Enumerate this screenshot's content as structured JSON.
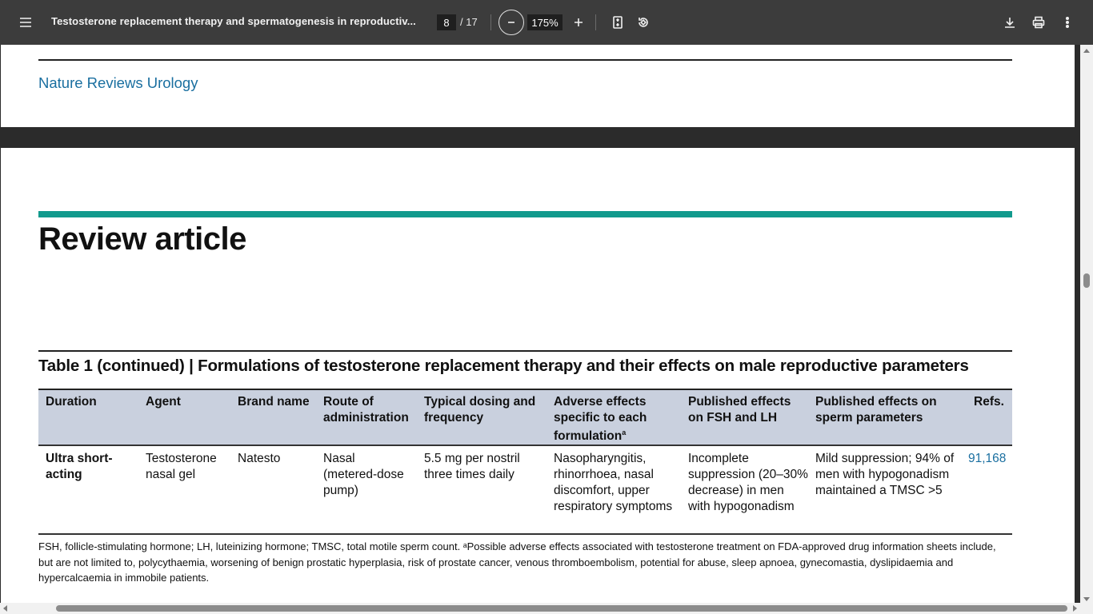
{
  "toolbar": {
    "title": "Testosterone replacement therapy and spermatogenesis in reproductiv...",
    "current_page": "8",
    "page_total": "/ 17",
    "zoom": "175%",
    "icons": [
      "menu-icon",
      "zoom-out-icon",
      "zoom-in-icon",
      "fit-page-icon",
      "rotate-icon",
      "download-icon",
      "print-icon",
      "more-vert-icon"
    ]
  },
  "prev_page": {
    "journal": "Nature Reviews Urology"
  },
  "page": {
    "article_type": "Review article",
    "table_title": "Table 1 (continued) | Formulations of testosterone replacement therapy and their effects on male reproductive parameters",
    "headers": [
      "Duration",
      "Agent",
      "Brand name",
      "Route of administration",
      "Typical dosing and frequency",
      "Adverse effects specific to each formulation",
      "Published effects on FSH and LH",
      "Published effects on sperm parameters",
      "Refs."
    ],
    "header_superscript": "a",
    "row": {
      "duration": "Ultra short-acting",
      "agent": "Testosterone nasal gel",
      "brand": "Natesto",
      "route": "Nasal (metered-dose pump)",
      "dosing": "5.5 mg per nostril three times daily",
      "adverse": "Nasopharyngitis, rhinorrhoea, nasal discomfort, upper respiratory symptoms",
      "fsh_lh": "Incomplete suppression (20–30% decrease) in men with hypogonadism",
      "sperm": "Mild suppression; 94% of men with hypogonadism maintained a TMSC >5",
      "refs": "91,168"
    },
    "footnote": "FSH, follicle-stimulating hormone; LH, luteinizing hormone; TMSC, total motile sperm count. ᵃPossible adverse effects associated with testosterone treatment on FDA-approved drug information sheets include, but are not limited to, polycythaemia, worsening of benign prostatic hyperplasia, risk of prostate cancer, venous thromboembolism, potential for abuse, sleep apnoea, gynecomastia, dyslipidaemia and hypercalcaemia in immobile patients."
  },
  "colors": {
    "toolbar_bg": "#3c3c3c",
    "viewer_bg": "#2b2b2b",
    "journal_blue": "#1a6fa0",
    "teal": "#119a8d",
    "table_header_bg": "#c9d0de"
  }
}
